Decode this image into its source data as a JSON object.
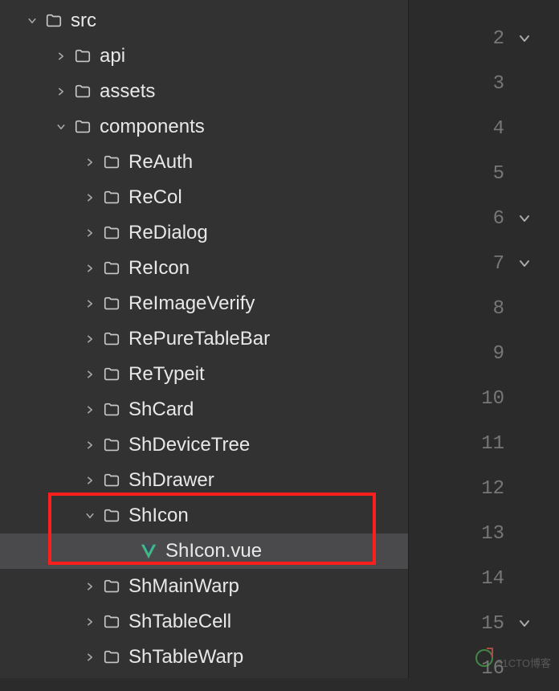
{
  "colors": {
    "folder": "#bdbdbd",
    "vue": "#41b883",
    "highlight": "#ff1e1e"
  },
  "tree": [
    {
      "depth": 0,
      "name": "src",
      "type": "folder",
      "expanded": true
    },
    {
      "depth": 1,
      "name": "api",
      "type": "folder",
      "expanded": false
    },
    {
      "depth": 1,
      "name": "assets",
      "type": "folder",
      "expanded": false
    },
    {
      "depth": 1,
      "name": "components",
      "type": "folder",
      "expanded": true
    },
    {
      "depth": 2,
      "name": "ReAuth",
      "type": "folder",
      "expanded": false
    },
    {
      "depth": 2,
      "name": "ReCol",
      "type": "folder",
      "expanded": false
    },
    {
      "depth": 2,
      "name": "ReDialog",
      "type": "folder",
      "expanded": false
    },
    {
      "depth": 2,
      "name": "ReIcon",
      "type": "folder",
      "expanded": false
    },
    {
      "depth": 2,
      "name": "ReImageVerify",
      "type": "folder",
      "expanded": false
    },
    {
      "depth": 2,
      "name": "RePureTableBar",
      "type": "folder",
      "expanded": false
    },
    {
      "depth": 2,
      "name": "ReTypeit",
      "type": "folder",
      "expanded": false
    },
    {
      "depth": 2,
      "name": "ShCard",
      "type": "folder",
      "expanded": false
    },
    {
      "depth": 2,
      "name": "ShDeviceTree",
      "type": "folder",
      "expanded": false
    },
    {
      "depth": 2,
      "name": "ShDrawer",
      "type": "folder",
      "expanded": false
    },
    {
      "depth": 2,
      "name": "ShIcon",
      "type": "folder",
      "expanded": true,
      "highlighted": true
    },
    {
      "depth": 3,
      "name": "ShIcon.vue",
      "type": "vue",
      "selected": true,
      "highlighted": true
    },
    {
      "depth": 2,
      "name": "ShMainWarp",
      "type": "folder",
      "expanded": false
    },
    {
      "depth": 2,
      "name": "ShTableCell",
      "type": "folder",
      "expanded": false
    },
    {
      "depth": 2,
      "name": "ShTableWarp",
      "type": "folder",
      "expanded": false
    }
  ],
  "gutter": [
    {
      "num": "2",
      "fold": true
    },
    {
      "num": "3",
      "fold": false
    },
    {
      "num": "4",
      "fold": false
    },
    {
      "num": "5",
      "fold": false
    },
    {
      "num": "6",
      "fold": true
    },
    {
      "num": "7",
      "fold": true
    },
    {
      "num": "8",
      "fold": false
    },
    {
      "num": "9",
      "fold": false
    },
    {
      "num": "10",
      "fold": false
    },
    {
      "num": "11",
      "fold": false
    },
    {
      "num": "12",
      "fold": false
    },
    {
      "num": "13",
      "fold": false
    },
    {
      "num": "14",
      "fold": false
    },
    {
      "num": "15",
      "fold": true
    },
    {
      "num": "16",
      "fold": false
    }
  ],
  "watermark": "51CTO博客"
}
